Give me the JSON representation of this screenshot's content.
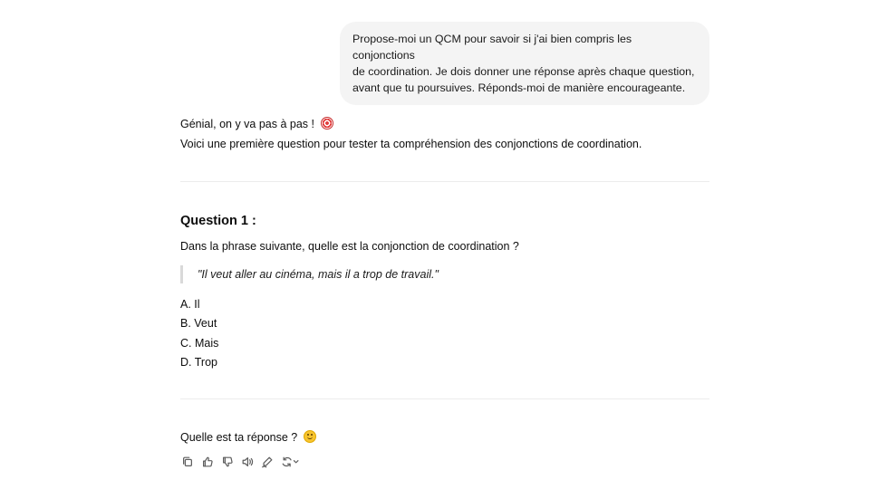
{
  "user_message": {
    "lines": [
      "Propose-moi un QCM pour savoir si j'ai bien compris les conjonctions",
      "de coordination. Je dois donner une réponse après chaque question,",
      "avant que tu poursuives. Réponds-moi de manière encourageante."
    ]
  },
  "assistant": {
    "intro_line_1": "Génial, on y va pas à pas !",
    "intro_emoji": "direct-hit-emoji",
    "intro_line_2": "Voici une première question pour tester ta compréhension des conjonctions de coordination.",
    "question_title": "Question 1 :",
    "question_text": "Dans la phrase suivante, quelle est la conjonction de coordination ?",
    "quote": "\"Il veut aller au cinéma, mais il a trop de travail.\"",
    "options": [
      "A. Il",
      "B. Veut",
      "C. Mais",
      "D. Trop"
    ],
    "closing": "Quelle est ta réponse ?",
    "closing_emoji": "smiling-face-emoji"
  },
  "action_icons": [
    "copy-icon",
    "thumbs-up-icon",
    "thumbs-down-icon",
    "read-aloud-icon",
    "edit-canvas-icon",
    "regenerate-icon"
  ]
}
